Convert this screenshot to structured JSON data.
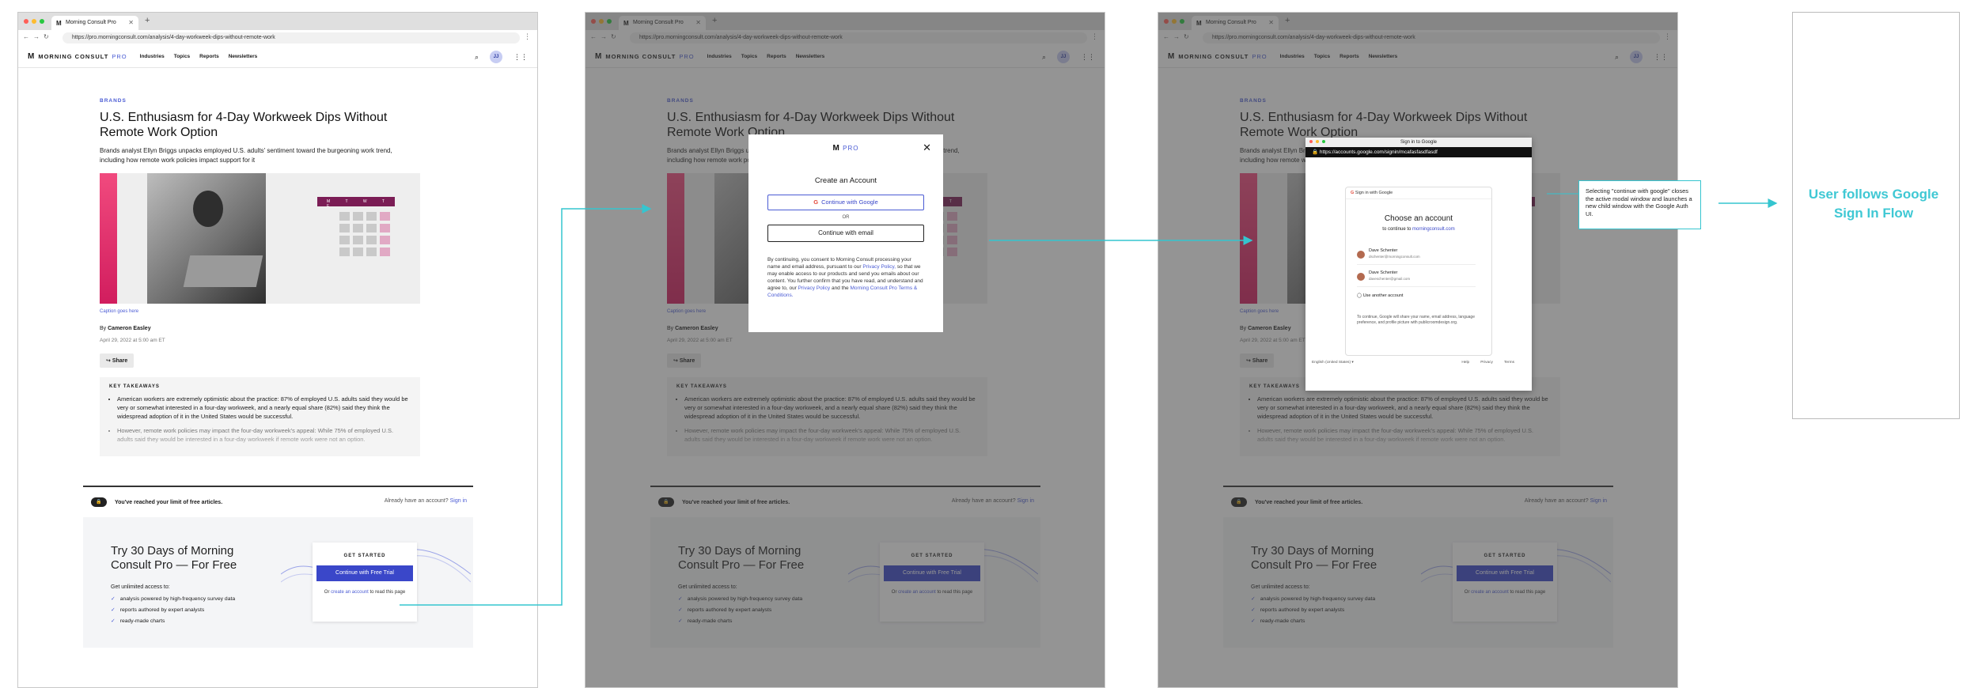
{
  "browser": {
    "tab_title": "Morning Consult Pro",
    "url": "https://pro.morningconsult.com/analysis/4-day-workweek-dips-without-remote-work",
    "google_popup_title": "Sign in to Google",
    "google_popup_url": "https://accounts.google.com/signin/mcafasfasdfasdf"
  },
  "site_nav": {
    "logo_text": "MORNING CONSULT",
    "logo_pro": "PRO",
    "links": [
      "Industries",
      "Topics",
      "Reports",
      "Newsletters"
    ],
    "avatar_initials": "JJ"
  },
  "article": {
    "kicker": "BRANDS",
    "headline": "U.S. Enthusiasm for 4-Day Workweek Dips Without Remote Work Option",
    "dek": "Brands analyst Ellyn Briggs unpacks employed U.S. adults' sentiment toward the burgeoning work trend, including how remote work policies impact support for it",
    "calendar_days": "M T W T F",
    "caption": "Caption goes here",
    "byline_prefix": "By",
    "author": "Cameron Easley",
    "date": "April 29, 2022 at 5:00 am ET",
    "share_label": "Share",
    "takeaways_heading": "KEY TAKEAWAYS",
    "takeaways": [
      "American workers are extremely optimistic about the practice: 87% of employed U.S. adults said they would be very or somewhat interested in a four-day workweek, and a nearly equal share (82%) said they think the widespread adoption of it in the United States would be successful.",
      "However, remote work policies may impact the four-day workweek's appeal: While 75% of employed U.S. adults said they would be interested in a four-day workweek if remote work were not an option."
    ]
  },
  "paywall": {
    "limit_text": "You've reached your limit of free articles.",
    "already_text": "Already have an account?",
    "sign_in": "Sign in",
    "trial_title": "Try 30 Days of Morning Consult Pro — For Free",
    "access_label": "Get unlimited access to:",
    "benefits": [
      "analysis powered by high-frequency survey data",
      "reports authored by expert analysts",
      "ready-made charts"
    ],
    "get_started": "GET STARTED",
    "cta_button": "Continue with Free Trial",
    "or_text": "Or",
    "create_account": "create an account",
    "read_text": "to read this page"
  },
  "modal": {
    "logo_pro": "PRO",
    "title": "Create an Account",
    "google_button": "Continue with Google",
    "or": "OR",
    "email_button": "Continue with email",
    "legal_1": "By continuing, you consent to Morning Consult processing your name and email address, pursuant to our",
    "privacy_policy": "Privacy Policy,",
    "legal_2": "so that we may enable access to our products and send you emails about our content. You further confirm that you have read, and understand and agree to, our",
    "privacy_policy_2": "Privacy Policy",
    "legal_3": "and the",
    "terms": "Morning Consult Pro Terms & Conditions."
  },
  "google": {
    "sign_in_with": "Sign in with Google",
    "choose": "Choose an account",
    "continue_to": "to continue to",
    "site": "morningconsult.com",
    "accounts": [
      {
        "name": "Dave Schenter",
        "email": "dschenter@morningconsult.com"
      },
      {
        "name": "Dave Schenter",
        "email": "daveschenter@gmail.com"
      }
    ],
    "use_another": "Use another account",
    "note": "To continue, Google will share your name, email address, language preference, and profile picture with publicroomdesign.org.",
    "language": "English (United States)",
    "footer_links": [
      "Help",
      "Privacy",
      "Terms"
    ]
  },
  "annotations": {
    "callout": "Selecting \"continue with google\" closes the active modal window and launches a new child window with the Google Auth UI.",
    "end_label": "User follows Google Sign In Flow"
  },
  "colors": {
    "accent": "#4a5bd4",
    "cta": "#3a47c9",
    "connector": "#35c5cf",
    "end_label": "#3fc8d4"
  }
}
